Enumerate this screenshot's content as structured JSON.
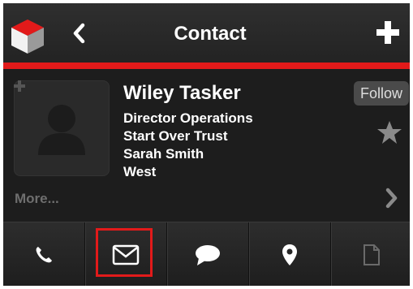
{
  "header": {
    "title": "Contact",
    "logo_icon": "cube-logo-icon",
    "back_icon": "chevron-left-icon",
    "add_icon": "plus-icon"
  },
  "accent_color": "#e21a1a",
  "contact": {
    "name": "Wiley Tasker",
    "title": "Director Operations",
    "company": "Start Over Trust",
    "owner": "Sarah Smith",
    "region": "West",
    "avatar_icon": "person-placeholder-icon"
  },
  "follow_label": "Follow",
  "favorite_icon": "star-icon",
  "more_label": "More...",
  "more_icon": "chevron-right-icon",
  "actions": [
    {
      "icon": "phone-icon"
    },
    {
      "icon": "email-icon",
      "highlighted": true
    },
    {
      "icon": "chat-icon"
    },
    {
      "icon": "location-pin-icon"
    },
    {
      "icon": "document-icon"
    }
  ]
}
